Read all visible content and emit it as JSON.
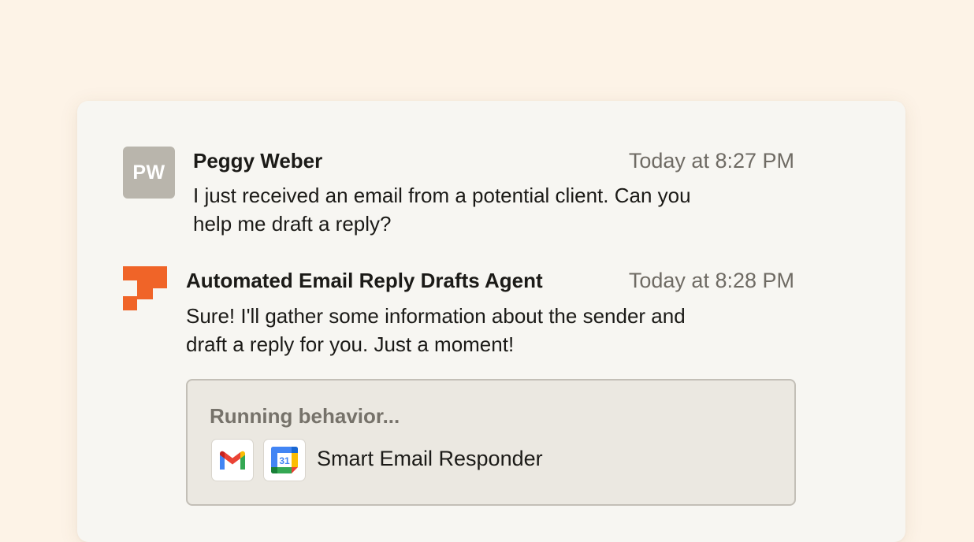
{
  "messages": [
    {
      "avatar_initials": "PW",
      "sender": "Peggy Weber",
      "time": "Today at 8:27 PM",
      "text_line1": "I just received an email from a potential client. Can you",
      "text_line2": "help me draft a reply?"
    },
    {
      "sender": "Automated Email Reply Drafts Agent",
      "time": "Today at 8:28 PM",
      "text_line1": "Sure! I'll gather some information about the sender and",
      "text_line2": "draft a reply for you. Just a moment!",
      "behavior": {
        "status": "Running behavior...",
        "apps": [
          "gmail-icon",
          "google-calendar-icon"
        ],
        "calendar_day": "31",
        "name": "Smart Email Responder"
      }
    }
  ],
  "colors": {
    "page_background": "#fdf3e7",
    "card_background": "#f7f6f2",
    "agent_brand": "#f06428",
    "avatar_background": "#b9b5ac"
  }
}
